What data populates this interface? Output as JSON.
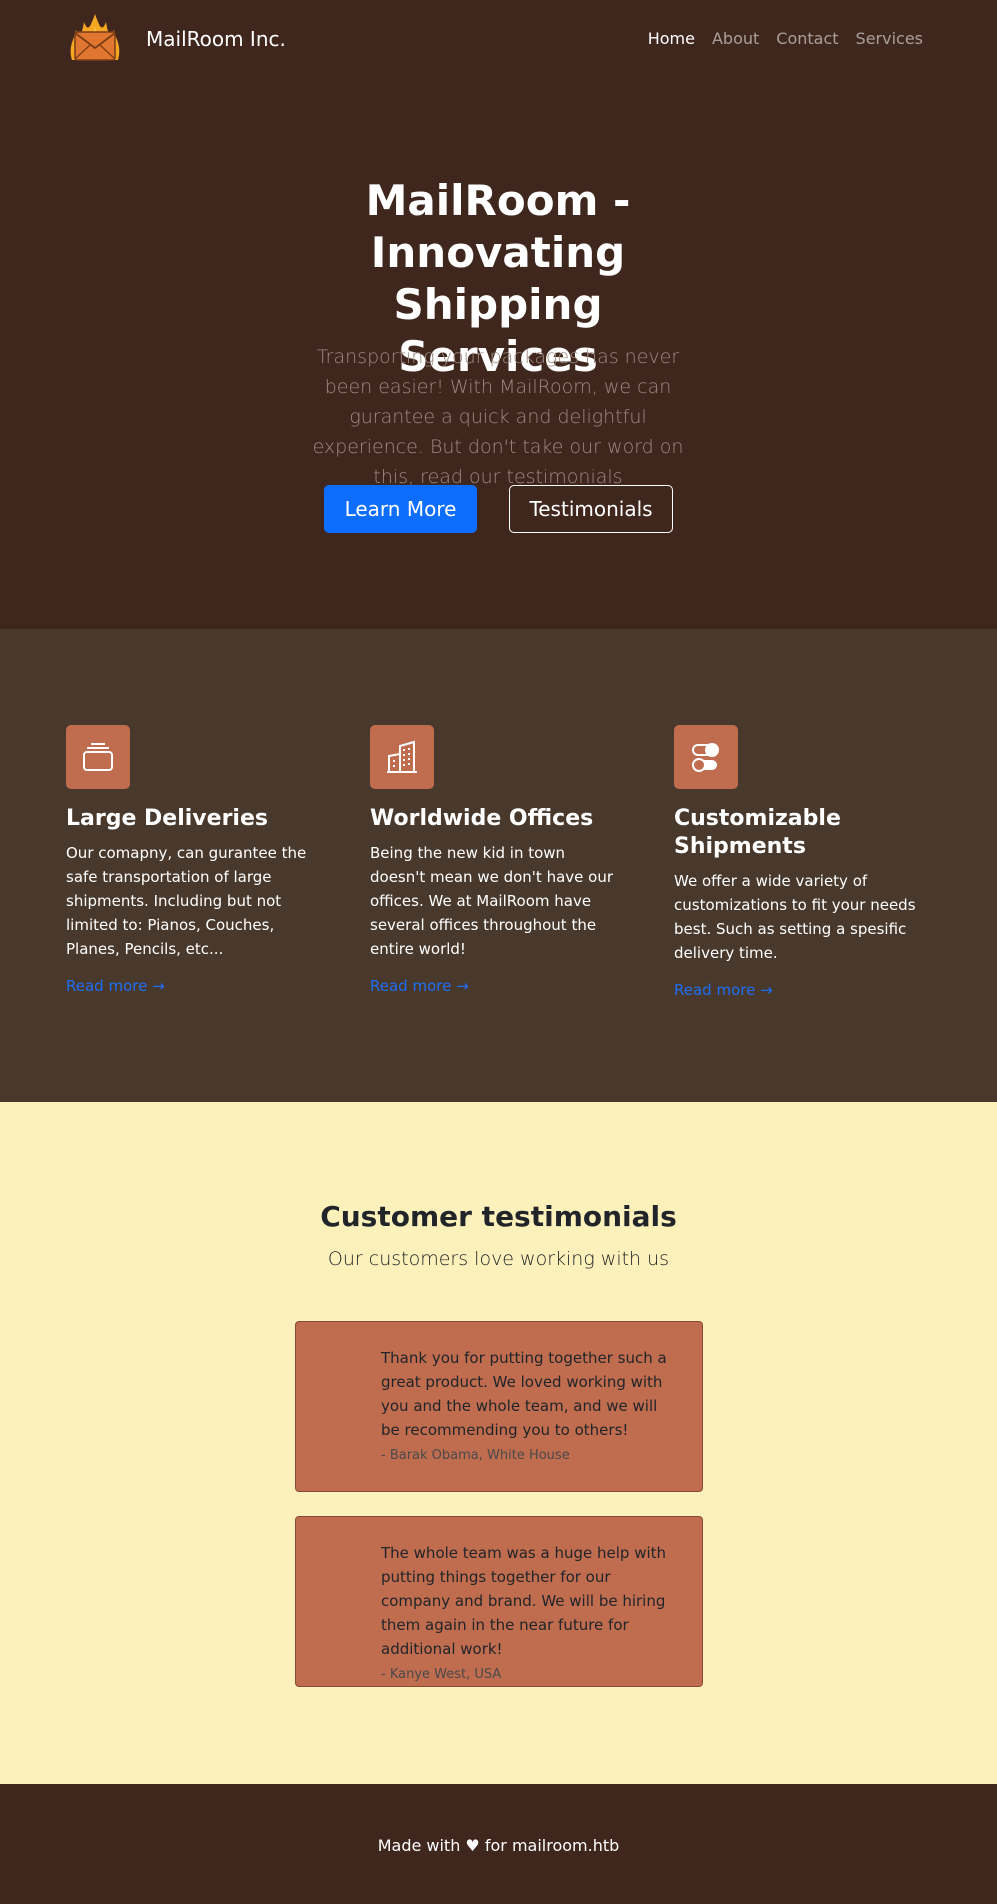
{
  "header": {
    "brand": "MailRoom Inc.",
    "logo_icon": "burning-envelope-logo",
    "nav": [
      {
        "label": "Home",
        "active": true
      },
      {
        "label": "About",
        "active": false
      },
      {
        "label": "Contact",
        "active": false
      },
      {
        "label": "Services",
        "active": false
      }
    ]
  },
  "hero": {
    "title": "MailRoom - Innovating Shipping Services",
    "subtitle": "Transporting your packages has never been easier! With MailRoom, we can gurantee a quick and delightful experience. But don't take our word on this, read our testimonials",
    "primary_button": "Learn More",
    "secondary_button": "Testimonials"
  },
  "features": [
    {
      "icon": "collection-icon",
      "title": "Large Deliveries",
      "text": "Our comapny, can gurantee the safe transportation of large shipments. Including but not limited to: Pianos, Couches, Planes, Pencils, etc...",
      "link": "Read more →"
    },
    {
      "icon": "building-icon",
      "title": "Worldwide Offices",
      "text": "Being the new kid in town doesn't mean we don't have our offices. We at MailRoom have several offices throughout the entire world!",
      "link": "Read more →"
    },
    {
      "icon": "toggles-icon",
      "title": "Customizable Shipments",
      "text": "We offer a wide variety of customizations to fit your needs best. Such as setting a spesific delivery time.",
      "link": "Read more →"
    }
  ],
  "testimonials": {
    "title": "Customer testimonials",
    "subtitle": "Our customers love working with us",
    "items": [
      {
        "quote": "Thank you for putting together such a great product. We loved working with you and the whole team, and we will be recommending you to others!",
        "author": "- Barak Obama, White House"
      },
      {
        "quote": "The whole team was a huge help with putting things together for our company and brand. We will be hiring them again in the near future for additional work!",
        "author": "- Kanye West, USA"
      }
    ]
  },
  "footer": {
    "text": "Made with ♥ for mailroom.htb"
  },
  "colors": {
    "header_bg": "#40271e",
    "features_bg": "#48392c",
    "testimonials_bg": "#fcf0bb",
    "accent": "#bf6c4f",
    "primary_blue": "#0d6efd"
  }
}
